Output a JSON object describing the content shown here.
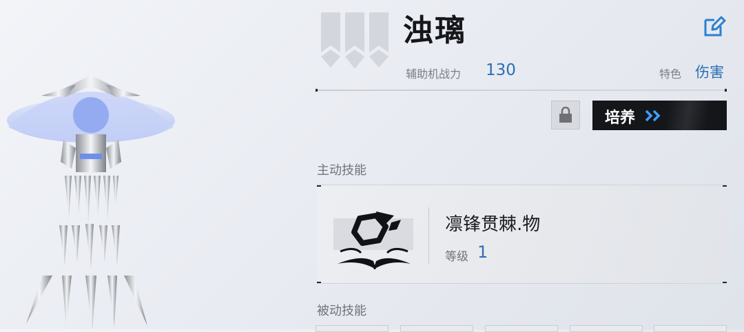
{
  "header": {
    "name": "浊璃",
    "power_label": "辅助机战力",
    "power_value": "130",
    "feature_label": "特色",
    "feature_value": "伤害"
  },
  "actions": {
    "cultivate_label": "培养"
  },
  "active_skill": {
    "section_label": "主动技能",
    "name": "凛锋贯棘.物",
    "level_label": "等级",
    "level_value": "1"
  },
  "passive_skill": {
    "section_label": "被动技能"
  },
  "colors": {
    "accent_blue": "#2b6fb3",
    "button_dark": "#15161a",
    "arrow_blue": "#3fa0ff"
  },
  "icons": [
    "rank-emblem",
    "edit-icon",
    "lock-icon",
    "double-chevron-icon",
    "skill-icon",
    "mech-figure"
  ]
}
